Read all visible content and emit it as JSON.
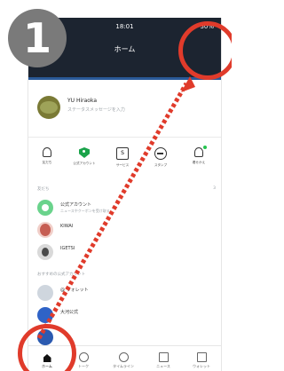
{
  "overlay": {
    "step_number": "1"
  },
  "statusbar": {
    "time": "18:01",
    "battery": "30%"
  },
  "header": {
    "title": "ホーム"
  },
  "profile": {
    "name": "YU Hiraoka",
    "status": "ステータスメッセージを入力"
  },
  "quick_actions": [
    {
      "label": "友だち"
    },
    {
      "label": "公式アカウント"
    },
    {
      "label": "サービス"
    },
    {
      "label": "スタンプ"
    },
    {
      "label": "着せかえ"
    }
  ],
  "sections": {
    "friends": {
      "title": "友だち",
      "count": "3"
    },
    "recommended": {
      "title": "おすすめの公式アカウント",
      "count": ""
    }
  },
  "friends": [
    {
      "title": "公式アカウント",
      "sub": "ニュースやクーポンを受け取る"
    },
    {
      "title": "KIWAI",
      "sub": ""
    },
    {
      "title": "IGETSI",
      "sub": ""
    }
  ],
  "recommended": [
    {
      "title": "@ ウォレット",
      "sub": ""
    },
    {
      "title": "大河公式",
      "sub": ""
    },
    {
      "title": "",
      "sub": ""
    }
  ],
  "tabs": [
    {
      "label": "ホーム"
    },
    {
      "label": "トーク"
    },
    {
      "label": "タイムライン"
    },
    {
      "label": "ニュース"
    },
    {
      "label": "ウォレット"
    }
  ]
}
